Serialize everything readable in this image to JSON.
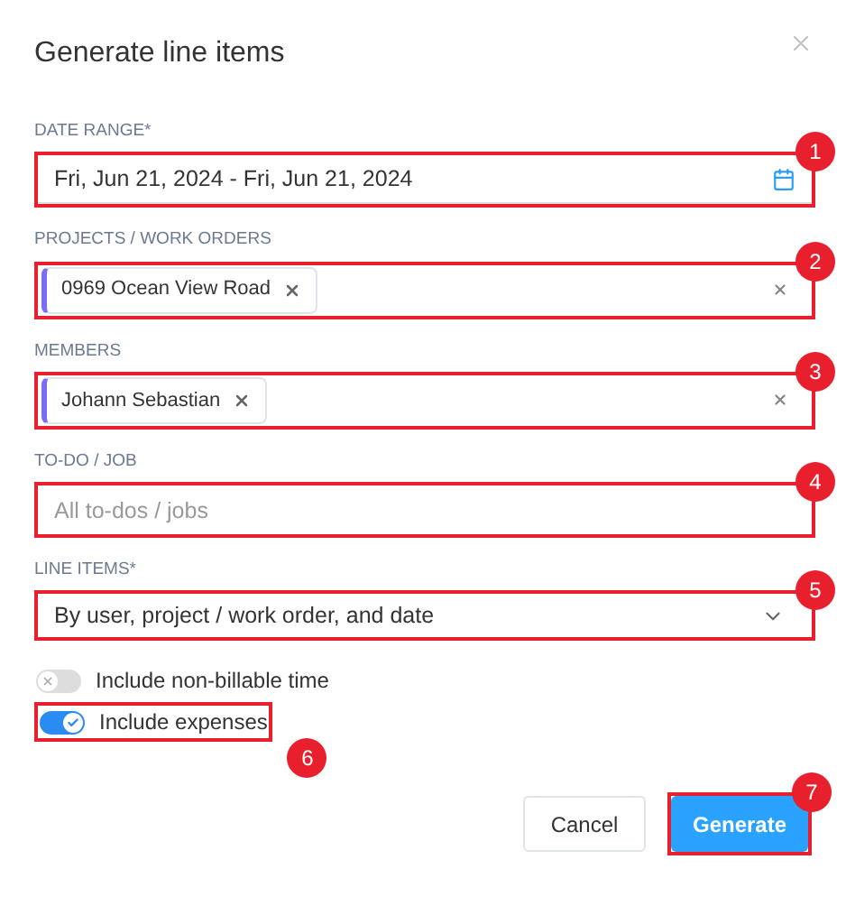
{
  "dialog": {
    "title": "Generate line items"
  },
  "fields": [
    {
      "kind": "date",
      "label": "DATE RANGE*",
      "value": "Fri, Jun 21, 2024 - Fri, Jun 21, 2024",
      "marker": "1"
    },
    {
      "kind": "tags",
      "label": "PROJECTS / WORK ORDERS",
      "tags": [
        "0969 Ocean View Road"
      ],
      "marker": "2"
    },
    {
      "kind": "tags",
      "label": "MEMBERS",
      "tags": [
        "Johann Sebastian"
      ],
      "marker": "3"
    },
    {
      "kind": "text",
      "label": "TO-DO / JOB",
      "placeholder": "All to-dos / jobs",
      "marker": "4"
    },
    {
      "kind": "select",
      "label": "LINE ITEMS*",
      "value": "By user, project / work order, and date",
      "marker": "5"
    }
  ],
  "toggles": [
    {
      "label": "Include non-billable time",
      "on": false
    },
    {
      "label": "Include expenses",
      "on": true,
      "marker": "6"
    }
  ],
  "buttons": [
    {
      "label": "Cancel",
      "kind": "secondary"
    },
    {
      "label": "Generate",
      "kind": "primary",
      "marker": "7"
    }
  ]
}
